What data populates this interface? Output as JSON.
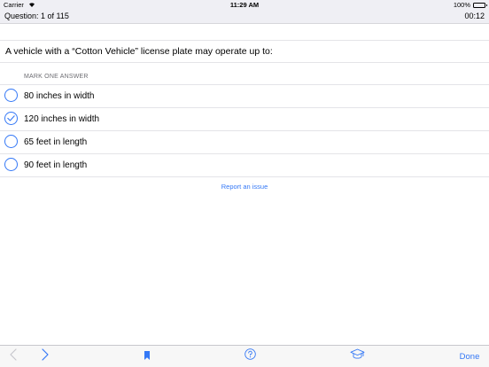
{
  "status_bar": {
    "carrier": "Carrier",
    "time": "11:29 AM",
    "battery": "100%"
  },
  "header": {
    "question_counter": "Question: 1 of 115",
    "timer": "00:12"
  },
  "question": {
    "text": "A vehicle with a “Cotton Vehicle” license plate may operate up to:"
  },
  "answers": {
    "instruction": "MARK ONE ANSWER",
    "options": [
      {
        "label": "80 inches in width",
        "selected": false
      },
      {
        "label": "120 inches in width",
        "selected": true
      },
      {
        "label": "65 feet in length",
        "selected": false
      },
      {
        "label": "90 feet in length",
        "selected": false
      }
    ]
  },
  "report_link": "Report an issue",
  "toolbar": {
    "done_label": "Done",
    "icons": [
      "chevron-left-icon",
      "chevron-right-icon",
      "bookmark-icon",
      "help-icon",
      "graduation-cap-icon"
    ]
  },
  "colors": {
    "accent": "#3478f6",
    "disabled": "#c7c7cc",
    "bar_background": "#efeff4"
  }
}
